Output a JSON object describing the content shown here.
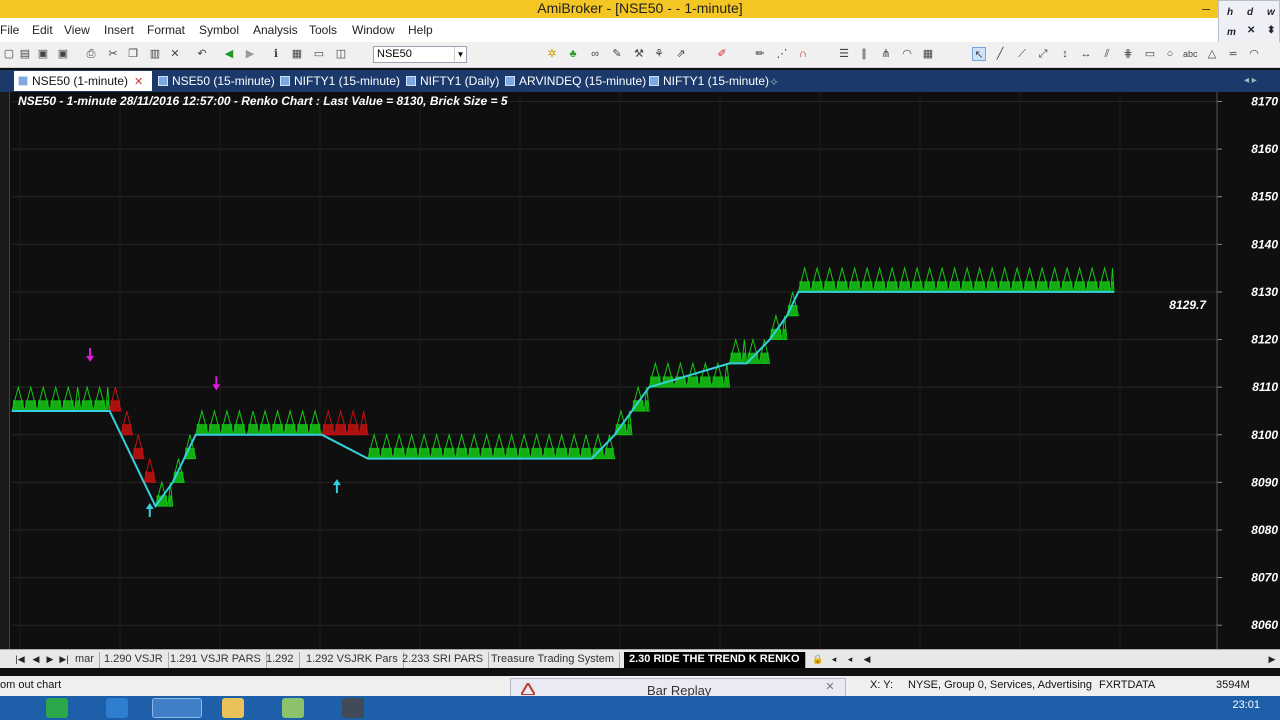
{
  "window": {
    "title": "AmiBroker - [NSE50 -  - 1-minute]",
    "minimize": "–"
  },
  "mini_panel": {
    "items": [
      "h",
      "d",
      "w",
      "m"
    ]
  },
  "menu": [
    "File",
    "Edit",
    "View",
    "Insert",
    "Format",
    "Symbol",
    "Analysis",
    "Tools",
    "Window",
    "Help"
  ],
  "toolbar": {
    "symbol_value": "NSE50"
  },
  "tabs": [
    {
      "label": "NSE50 (1-minute)",
      "active": true
    },
    {
      "label": "NSE50 (15-minute)"
    },
    {
      "label": "NIFTY1 (15-minute)"
    },
    {
      "label": "NIFTY1 (Daily)"
    },
    {
      "label": "ARVINDEQ (15-minute)"
    },
    {
      "label": "NIFTY1 (15-minute)"
    }
  ],
  "chart_title": "NSE50 - 1-minute 28/11/2016 12:57:00 - Renko Chart : Last Value = 8130, Brick Size = 5",
  "chart_data": {
    "type": "line",
    "title": "NSE50 - 1-minute 28/11/2016 12:57:00 - Renko Chart : Last Value = 8130, Brick Size = 5",
    "ylim": [
      8055,
      8172
    ],
    "y_ticks": [
      8170,
      8160,
      8150,
      8140,
      8130,
      8120,
      8110,
      8100,
      8090,
      8080,
      8070,
      8060
    ],
    "last_value_label": "8129.7",
    "brick_size": 5,
    "series": [
      {
        "name": "",
        "color": "#35d0dd",
        "steps": [
          [
            0,
            8105
          ],
          [
            0.06,
            8105
          ],
          [
            0.06,
            8105
          ],
          [
            0.085,
            8105
          ],
          [
            0.095,
            8100
          ],
          [
            0.105,
            8095
          ],
          [
            0.115,
            8090
          ],
          [
            0.125,
            8085
          ],
          [
            0.14,
            8090
          ],
          [
            0.15,
            8095
          ],
          [
            0.16,
            8100
          ],
          [
            0.205,
            8100
          ],
          [
            0.215,
            8100
          ],
          [
            0.27,
            8100
          ],
          [
            0.31,
            8095
          ],
          [
            0.505,
            8095
          ],
          [
            0.525,
            8100
          ],
          [
            0.54,
            8105
          ],
          [
            0.555,
            8110
          ],
          [
            0.625,
            8115
          ],
          [
            0.64,
            8115
          ],
          [
            0.66,
            8120
          ],
          [
            0.675,
            8125
          ],
          [
            0.685,
            8130
          ],
          [
            0.96,
            8130
          ]
        ]
      }
    ],
    "buy_arrows": [
      [
        0.12,
        8084
      ],
      [
        0.283,
        8089
      ]
    ],
    "sell_arrows": [
      [
        0.068,
        8117
      ],
      [
        0.178,
        8111
      ]
    ],
    "colors": {
      "up_brick": "#14c814",
      "down_brick": "#c41010",
      "stop_line": "#35d0dd",
      "background": "#0f0f0f"
    }
  },
  "sheets": [
    "mar",
    "1.290 VSJR",
    "1.291 VSJR PARS",
    "1.292",
    "1.292 VSJRK Pars",
    "2.233 SRI PARS",
    "Treasure Trading System",
    "2.30 RIDE THE TREND K RENKO"
  ],
  "status": {
    "left": "om out chart",
    "xy": "X:  Y:",
    "info": "NYSE, Group 0, Services, Advertising",
    "source": "FXRTDATA",
    "memory": "3594M"
  },
  "replay": {
    "title": "Bar Replay"
  },
  "taskbar": {
    "time": "23:01"
  }
}
